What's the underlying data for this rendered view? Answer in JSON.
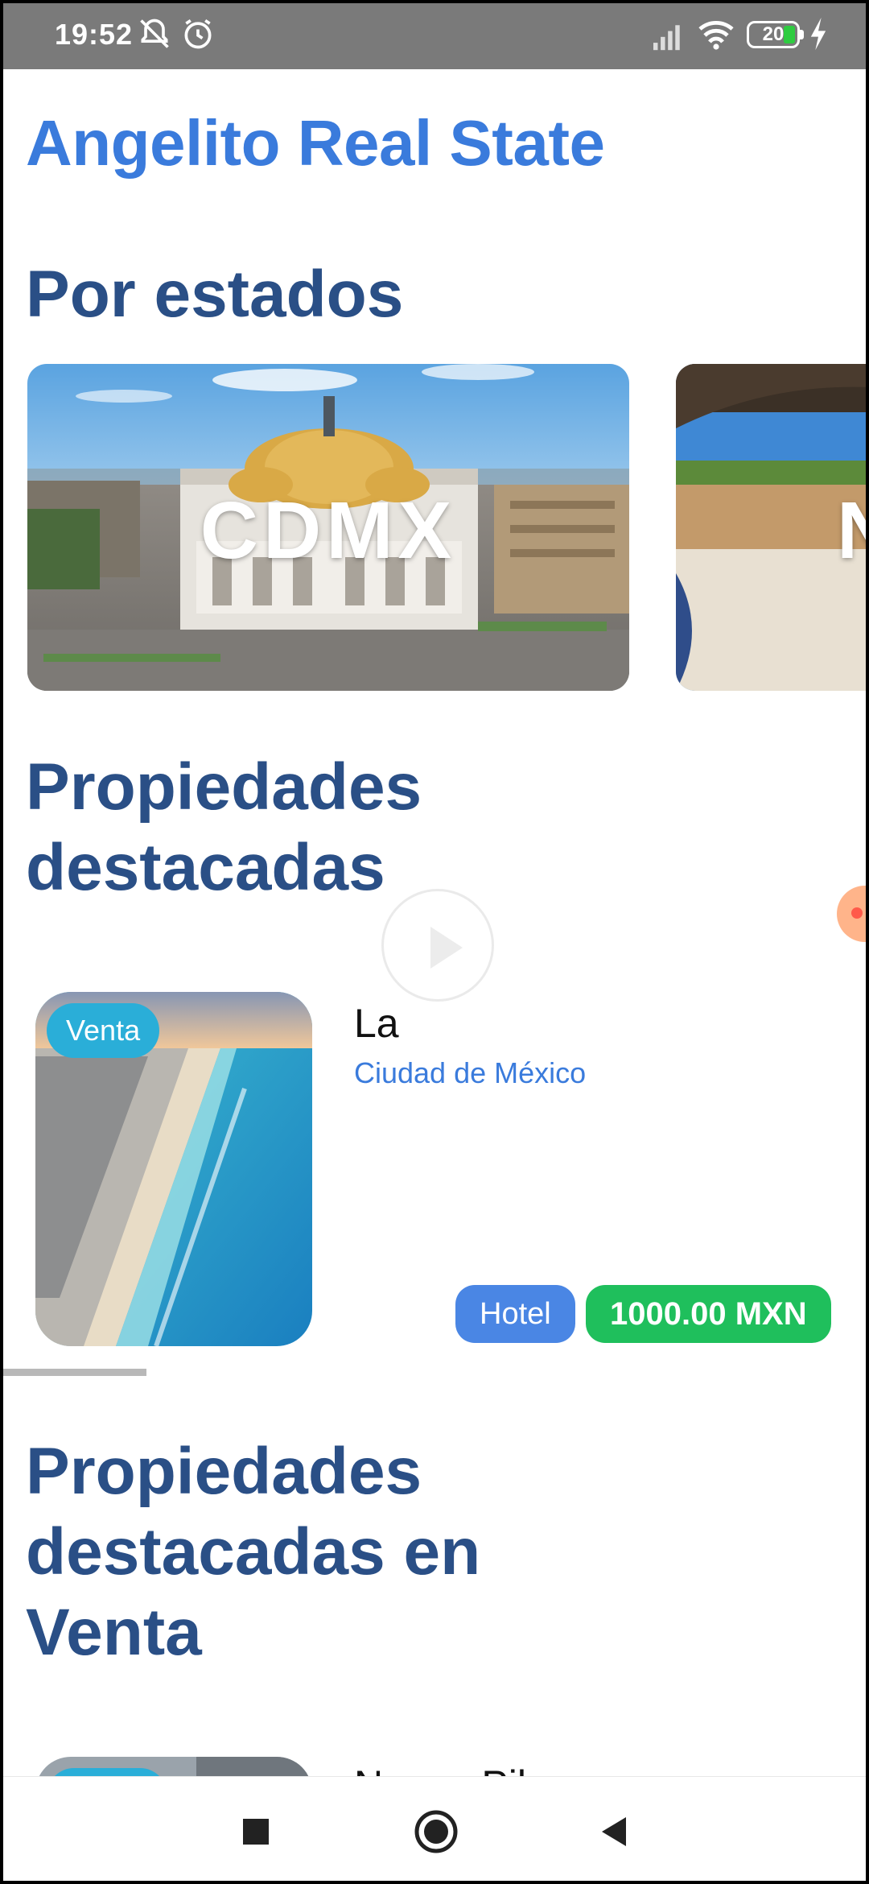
{
  "status_bar": {
    "time": "19:52",
    "battery_level": "20",
    "icons": [
      "bell-off-icon",
      "alarm-icon",
      "signal-icon",
      "wifi-icon",
      "battery-icon",
      "bolt-icon"
    ]
  },
  "app": {
    "title": "Angelito Real State"
  },
  "sections": {
    "states_title": "Por estados",
    "featured_title": "Propiedades destacadas",
    "featured_sale_title": "Propiedades destacadas en Venta"
  },
  "states": [
    {
      "label": "CDMX"
    },
    {
      "label": "N"
    }
  ],
  "featured": {
    "badge": "Venta",
    "name": "La",
    "city": "Ciudad de México",
    "type": "Hotel",
    "price": "1000.00 MXN"
  },
  "featured_sale": {
    "name": "Nuevo Pil"
  },
  "nav": {
    "icons": [
      "recent-apps-icon",
      "home-icon",
      "back-icon"
    ]
  },
  "colors": {
    "title_blue": "#3a7bdc",
    "section_navy": "#2a4f86",
    "badge_cyan": "#2aaed8",
    "price_green": "#1fbf5c",
    "type_blue": "#4a86e4"
  }
}
